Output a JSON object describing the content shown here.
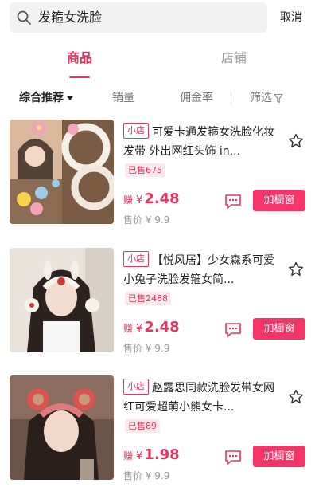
{
  "search": {
    "query": "发箍女洗脸",
    "cancel_label": "取消"
  },
  "tabs": {
    "goods": "商品",
    "shop": "店铺"
  },
  "sort": {
    "comprehensive": "综合推荐",
    "sales": "销量",
    "commission": "佣金率",
    "filter": "筛选"
  },
  "colors": {
    "accent": "#e8345c",
    "button": "#f4356a",
    "badge_bg": "#fde8ed"
  },
  "icons": [
    "search-icon",
    "caret-down-icon",
    "filter-icon",
    "star-icon",
    "message-icon"
  ],
  "products": [
    {
      "shop_tag": "小店",
      "title": "可爱卡通发箍女洗脸化妆发带 外出网红头饰 in...",
      "sold": "已售675",
      "earn_label": "赚",
      "currency": "¥",
      "earn_value": "2.48",
      "price": "售价 ¥ 9.9",
      "button": "加橱窗"
    },
    {
      "shop_tag": "小店",
      "title": "【悦风居】少女森系可爱小兔子洗脸发箍女简...",
      "sold": "已售2488",
      "earn_label": "赚",
      "currency": "¥",
      "earn_value": "2.48",
      "price": "售价 ¥ 9.9",
      "button": "加橱窗"
    },
    {
      "shop_tag": "小店",
      "title": "赵露思同款洗脸发带女网红可爱超萌小熊女卡...",
      "sold": "已售89",
      "earn_label": "赚",
      "currency": "¥",
      "earn_value": "1.98",
      "price": "售价 ¥ 9.9",
      "button": "加橱窗"
    }
  ]
}
